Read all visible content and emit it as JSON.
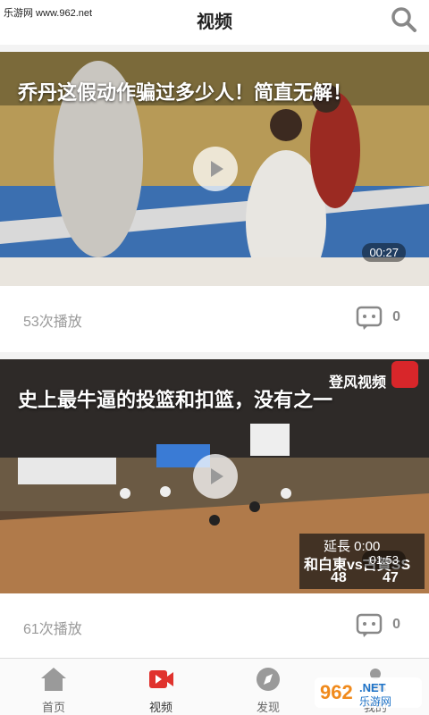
{
  "header": {
    "watermark": "乐游网 www.962.net",
    "title": "视频"
  },
  "videos": [
    {
      "title": "乔丹这假动作骗过多少人！简直无解！",
      "duration": "00:27",
      "plays": "53次播放",
      "comments": "0"
    },
    {
      "title": "史上最牛逼的投篮和扣篮，没有之一",
      "duration": "01:53",
      "plays": "61次播放",
      "comments": "0",
      "overlay_channel": "登风视频",
      "score_text": "延長 0:00",
      "teams": "和白東vs古賀SS",
      "score_left": "48",
      "score_right": "47"
    }
  ],
  "nav": {
    "items": [
      {
        "label": "首页",
        "icon": "home-icon"
      },
      {
        "label": "视频",
        "icon": "video-icon",
        "active": true
      },
      {
        "label": "发现",
        "icon": "compass-icon"
      },
      {
        "label": "我的",
        "icon": "user-icon"
      }
    ]
  },
  "brand": "962.NET 乐游网",
  "colors": {
    "accent": "#e0322d",
    "nav_gray": "#9a9a9a"
  }
}
